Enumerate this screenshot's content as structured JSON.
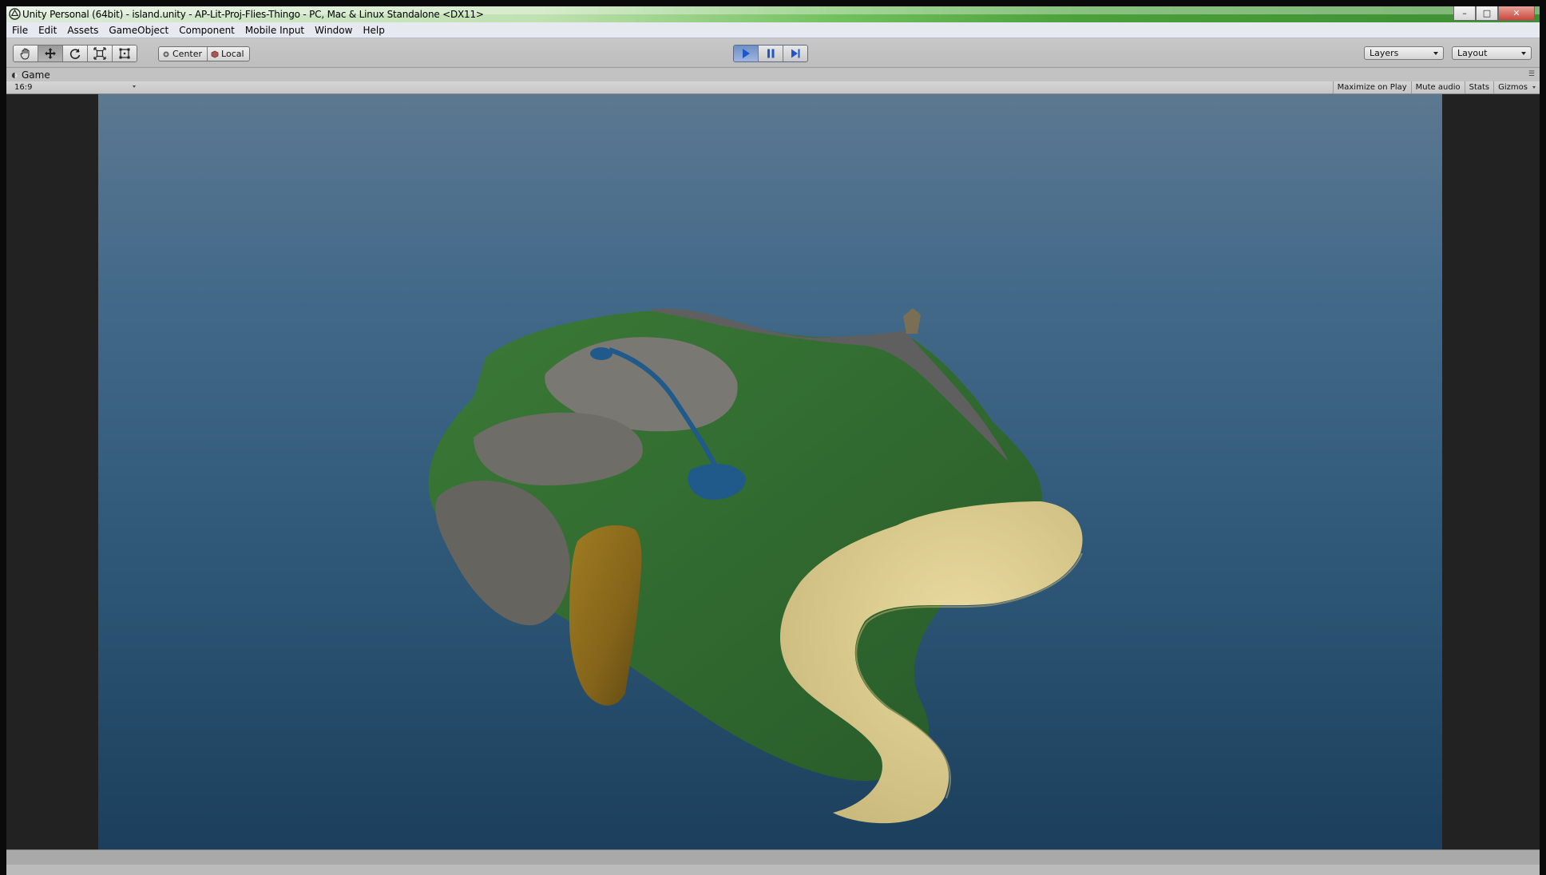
{
  "window": {
    "title": "Unity Personal (64bit) - island.unity - AP-Lit-Proj-Flies-Thingo - PC, Mac & Linux Standalone <DX11>",
    "controls": {
      "minimize": "–",
      "maximize": "□",
      "close": "✕"
    }
  },
  "menu": {
    "items": [
      {
        "label": "File"
      },
      {
        "label": "Edit"
      },
      {
        "label": "Assets"
      },
      {
        "label": "GameObject"
      },
      {
        "label": "Component"
      },
      {
        "label": "Mobile Input"
      },
      {
        "label": "Window"
      },
      {
        "label": "Help"
      }
    ]
  },
  "toolbar": {
    "tools": [
      {
        "icon": "hand-icon",
        "active": false
      },
      {
        "icon": "move-icon",
        "active": true
      },
      {
        "icon": "rotate-icon",
        "active": false
      },
      {
        "icon": "scale-icon",
        "active": false
      },
      {
        "icon": "rect-icon",
        "active": false
      }
    ],
    "pivot_label": "Center",
    "space_label": "Local",
    "play": {
      "playing": true,
      "paused": false
    },
    "layers_label": "Layers",
    "layout_label": "Layout"
  },
  "game_view": {
    "tab_label": "Game",
    "aspect": "16:9",
    "maximize_on_play": "Maximize on Play",
    "mute_audio": "Mute audio",
    "stats": "Stats",
    "gizmos": "Gizmos"
  },
  "colors": {
    "ocean": "#2f5878",
    "grass": "#2f6a30",
    "rock": "#6b6a66",
    "sand": "#d8c98e",
    "dirt": "#8a6a1c",
    "water": "#1f5a8a",
    "play_active": "#6e8ec4"
  }
}
